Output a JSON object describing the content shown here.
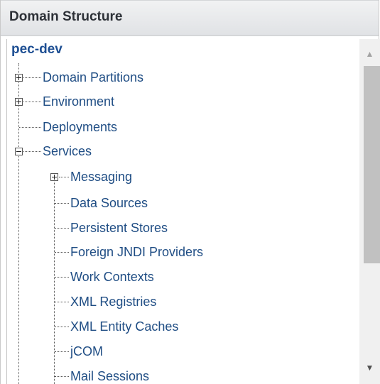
{
  "panel": {
    "title": "Domain Structure"
  },
  "tree": {
    "root": "pec-dev",
    "nodes": [
      {
        "label": "Domain Partitions",
        "state": "collapsed"
      },
      {
        "label": "Environment",
        "state": "collapsed"
      },
      {
        "label": "Deployments",
        "state": "leaf"
      },
      {
        "label": "Services",
        "state": "expanded",
        "children": [
          {
            "label": "Messaging",
            "state": "collapsed"
          },
          {
            "label": "Data Sources",
            "state": "leaf"
          },
          {
            "label": "Persistent Stores",
            "state": "leaf"
          },
          {
            "label": "Foreign JNDI Providers",
            "state": "leaf"
          },
          {
            "label": "Work Contexts",
            "state": "leaf"
          },
          {
            "label": "XML Registries",
            "state": "leaf"
          },
          {
            "label": "XML Entity Caches",
            "state": "leaf"
          },
          {
            "label": "jCOM",
            "state": "leaf"
          },
          {
            "label": "Mail Sessions",
            "state": "leaf"
          }
        ]
      }
    ]
  },
  "scrollbar": {
    "up_icon": "▲",
    "down_icon": "▼"
  }
}
